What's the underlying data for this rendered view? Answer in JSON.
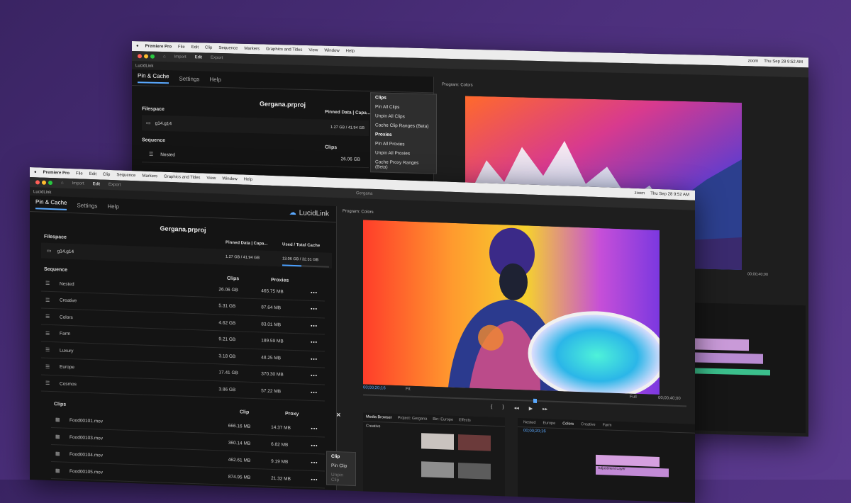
{
  "back_window": {
    "menu": [
      "Premiere Pro",
      "File",
      "Edit",
      "Clip",
      "Sequence",
      "Markers",
      "Graphics and Titles",
      "View",
      "Window",
      "Help"
    ],
    "menu_right": [
      "zoom",
      "Thu Sep 28 9:52 AM"
    ],
    "workspace_tabs": [
      "Import",
      "Edit",
      "Export"
    ],
    "panel_title": "LucidLink",
    "tabs": [
      "Pin & Cache",
      "Settings",
      "Help"
    ],
    "logo": "LucidLink",
    "project": "Gergana.prproj",
    "filespace_label": "Filespace",
    "filespace": "g14.g14",
    "pinned_header": "Pinned Data | Capa...",
    "pinned_value": "1.27 GB / 41.94 GB",
    "sequence_label": "Sequence",
    "clips_header": "Clips",
    "seq_row": {
      "name": "Nested",
      "clips": "26.06 GB"
    },
    "program_label": "Program: Colors",
    "context_menu": {
      "clips_header": "Clips",
      "clips_items": [
        "Pin All Clips",
        "Unpin All Clips",
        "Cache Clip Ranges (Beta)"
      ],
      "proxies_header": "Proxies",
      "proxies_items": [
        "Pin All Proxies",
        "Unpin All Proxies",
        "Cache Proxy Ranges (Beta)"
      ]
    },
    "timecode": "00;00;40;00"
  },
  "front_window": {
    "menu": [
      "Premiere Pro",
      "File",
      "Edit",
      "Clip",
      "Sequence",
      "Markers",
      "Graphics and Titles",
      "View",
      "Window",
      "Help"
    ],
    "menu_right": [
      "zoom",
      "Thu Sep 28 9:52 AM"
    ],
    "workspace_tabs": [
      "Import",
      "Edit",
      "Export"
    ],
    "window_title": "Gergana",
    "panel_title": "LucidLink",
    "tabs": [
      "Pin & Cache",
      "Settings",
      "Help"
    ],
    "logo": "LucidLink",
    "project": "Gergana.prproj",
    "filespace_label": "Filespace",
    "filespace": "g14.g14",
    "pinned_header": "Pinned Data | Capa...",
    "pinned_value": "1.27 GB / 41.94 GB",
    "used_header": "Used / Total Cache",
    "used_value": "13.06 GB / 32.31 GB",
    "used_fill": 0.41,
    "sequence_label": "Sequence",
    "clips_header": "Clips",
    "proxies_header": "Proxies",
    "sequences": [
      {
        "name": "Nested",
        "clips": "26.06 GB",
        "proxies": "465.75 MB"
      },
      {
        "name": "Creative",
        "clips": "5.31 GB",
        "proxies": "87.64 MB"
      },
      {
        "name": "Colors",
        "clips": "4.62 GB",
        "proxies": "83.01 MB"
      },
      {
        "name": "Farm",
        "clips": "9.21 GB",
        "proxies": "189.59 MB"
      },
      {
        "name": "Luxury",
        "clips": "3.18 GB",
        "proxies": "48.25 MB"
      },
      {
        "name": "Europe",
        "clips": "17.41 GB",
        "proxies": "370.30 MB"
      },
      {
        "name": "Cosmos",
        "clips": "3.86 GB",
        "proxies": "57.22 MB"
      }
    ],
    "clips_section": "Clips",
    "clip_col": "Clip",
    "proxy_col": "Proxy",
    "close": "✕",
    "clips": [
      {
        "name": "Food00101.mov",
        "clip": "666.16 MB",
        "proxy": "14.37 MB"
      },
      {
        "name": "Food00103.mov",
        "clip": "360.14 MB",
        "proxy": "6.82 MB"
      },
      {
        "name": "Food00104.mov",
        "clip": "462.61 MB",
        "proxy": "9.19 MB"
      },
      {
        "name": "Food00105.mov",
        "clip": "874.95 MB",
        "proxy": "21.32 MB"
      }
    ],
    "clip_menu": {
      "header": "Clip",
      "items": [
        "Pin Clip",
        "Unpin Clip"
      ]
    },
    "program_label": "Program: Colors",
    "timecode_left": "00;00;20;16",
    "timecode_right": "00;00;40;00",
    "fit": "Fit",
    "full": "Full",
    "media_tabs": [
      "Media Browser",
      "Project: Gergana",
      "Bin: Europe",
      "Effects"
    ],
    "media_bin": "Creative",
    "timeline_tabs": [
      "Nested",
      "Europe",
      "Colors",
      "Creative",
      "Farm"
    ],
    "timeline_timecode": "00;00;20;16",
    "adjustment_label": "Adjustment Layer"
  },
  "colors": {
    "accent": "#4aa0ff",
    "bg": "#1e1e1e",
    "purple": "#4c2f7c"
  }
}
